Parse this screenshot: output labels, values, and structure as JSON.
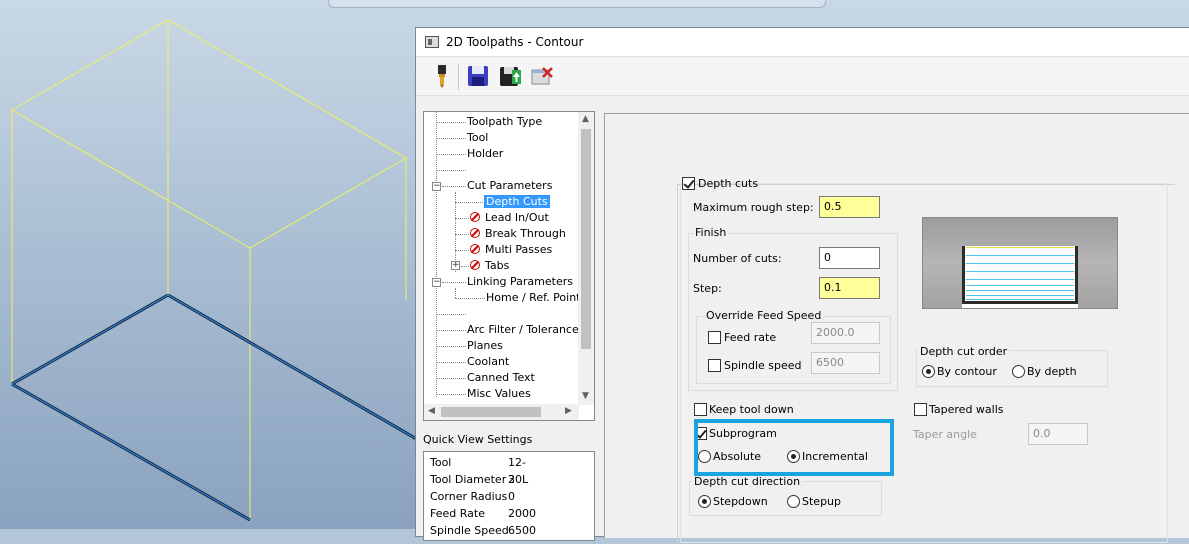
{
  "dialog": {
    "title": "2D Toolpaths - Contour"
  },
  "toolbar": {
    "icons": [
      "tool-icon",
      "save-icon",
      "save-all-icon",
      "cancel-icon"
    ]
  },
  "tree": {
    "items": [
      {
        "label": "Toolpath Type"
      },
      {
        "label": "Tool"
      },
      {
        "label": "Holder"
      },
      {
        "label": ""
      },
      {
        "label": "Cut Parameters"
      },
      {
        "label": "Depth Cuts"
      },
      {
        "label": "Lead In/Out"
      },
      {
        "label": "Break Through"
      },
      {
        "label": "Multi Passes"
      },
      {
        "label": "Tabs"
      },
      {
        "label": "Linking Parameters"
      },
      {
        "label": "Home / Ref. Points"
      },
      {
        "label": ""
      },
      {
        "label": "Arc Filter / Tolerance"
      },
      {
        "label": "Planes"
      },
      {
        "label": "Coolant"
      },
      {
        "label": "Canned Text"
      },
      {
        "label": "Misc Values"
      }
    ]
  },
  "quick_view": {
    "title": "Quick View Settings",
    "rows": [
      {
        "key": "Tool",
        "value": "12-30L"
      },
      {
        "key": "Tool Diameter",
        "value": "2"
      },
      {
        "key": "Corner Radius",
        "value": "0"
      },
      {
        "key": "Feed Rate",
        "value": "2000"
      },
      {
        "key": "Spindle Speed",
        "value": "6500"
      }
    ]
  },
  "depth_cuts": {
    "enable_label": "Depth cuts",
    "enabled": true,
    "max_rough_step_label": "Maximum rough step:",
    "max_rough_step": "0.5",
    "finish_group": "Finish",
    "num_cuts_label": "Number of cuts:",
    "num_cuts": "0",
    "step_label": "Step:",
    "step": "0.1",
    "override_group": "Override Feed Speed",
    "feed_rate_label": "Feed rate",
    "feed_rate": "2000.0",
    "spindle_speed_label": "Spindle speed",
    "spindle_speed": "6500",
    "order_group": "Depth cut order",
    "by_contour": "By contour",
    "by_depth": "By depth",
    "keep_tool_down": "Keep tool down",
    "subprogram": "Subprogram",
    "absolute": "Absolute",
    "incremental": "Incremental",
    "direction_group": "Depth cut direction",
    "stepdown": "Stepdown",
    "stepup": "Stepup",
    "tapered_walls": "Tapered walls",
    "taper_angle_label": "Taper angle",
    "taper_angle": "0.0"
  },
  "colors": {
    "highlight_border": "#1aa3e0",
    "yellow_field": "#ffff99",
    "selection": "#3399ff"
  }
}
